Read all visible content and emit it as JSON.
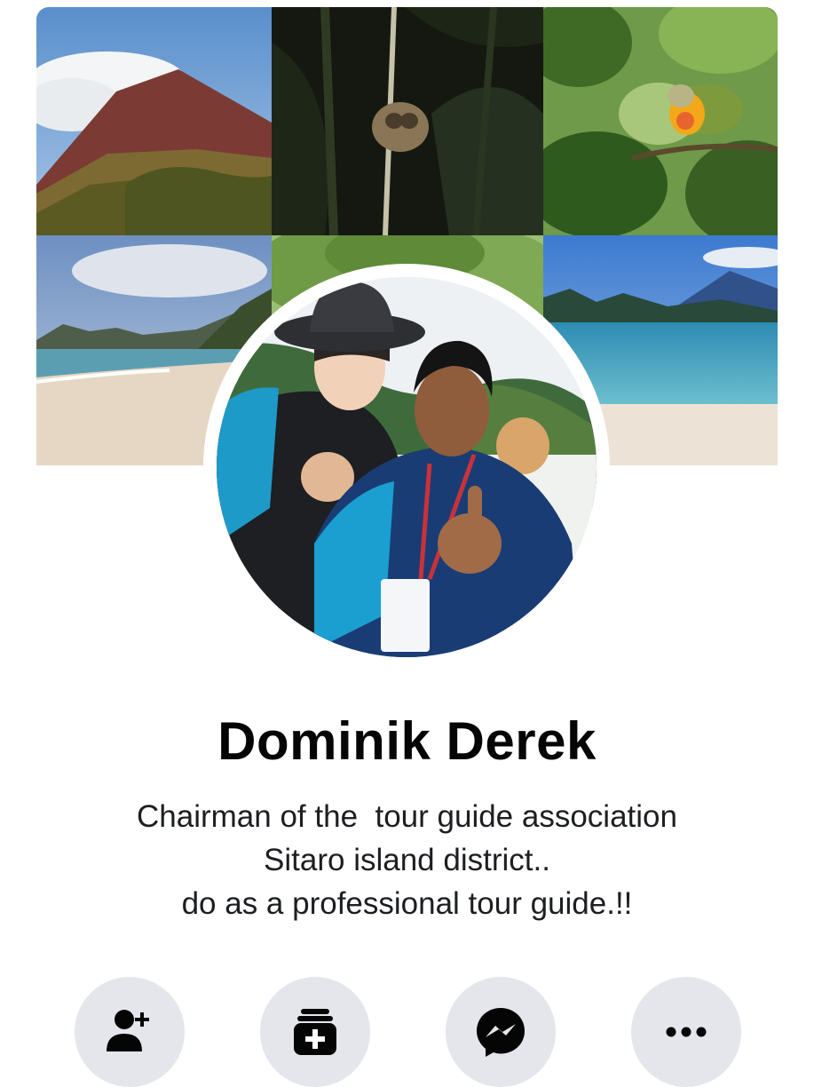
{
  "profile": {
    "name": "Dominik Derek",
    "bio_lines": [
      "Chairman of the  tour guide association",
      "Sitaro island district..",
      "do as a professional tour guide.!!"
    ]
  },
  "cover": {
    "tiles": [
      "volcano-mountain",
      "tarsier-on-branch",
      "fruit-dove-bird",
      "beach-with-islands",
      "forest-hillside",
      "sea-bay-with-volcano"
    ]
  },
  "actions": [
    {
      "name": "add-friend",
      "icon": "person-add-icon"
    },
    {
      "name": "add-to-story",
      "icon": "story-add-icon"
    },
    {
      "name": "message",
      "icon": "messenger-icon"
    },
    {
      "name": "more-options",
      "icon": "more-dots-icon"
    }
  ],
  "colors": {
    "button_bg": "#e4e6eb",
    "icon": "#050505",
    "text": "#050505"
  }
}
